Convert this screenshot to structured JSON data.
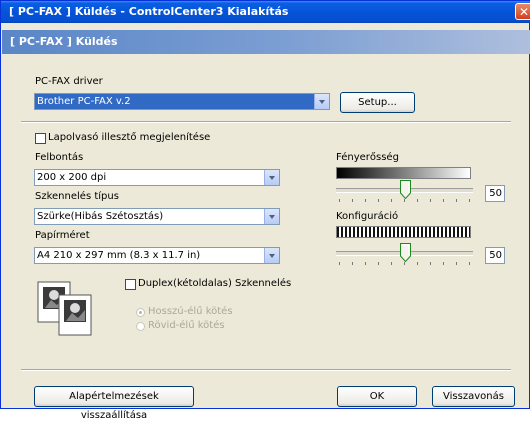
{
  "window": {
    "title": "[ PC-FAX ]  Küldés - ControlCenter3 Kialakítás",
    "close_glyph": "✕"
  },
  "header": {
    "title": "[ PC-FAX ]  Küldés"
  },
  "driver": {
    "label": "PC-FAX driver",
    "value": "Brother PC-FAX v.2",
    "setup_label": "Setup..."
  },
  "preview": {
    "checkbox_label": "Lapolvasó illesztő megjelenítése",
    "checked": false
  },
  "resolution": {
    "label": "Felbontás",
    "value": "200 x 200 dpi"
  },
  "scan_type": {
    "label": "Szkennelés típus",
    "value": "Szürke(Hibás Szétosztás)"
  },
  "paper_size": {
    "label": "Papírméret",
    "value": "A4 210 x 297 mm (8.3 x 11.7 in)"
  },
  "duplex": {
    "checkbox_label": "Duplex(kétoldalas) Szkennelés",
    "checked": false,
    "options": [
      {
        "label": "Hosszú-élű kötés",
        "selected": true
      },
      {
        "label": "Rövid-élű kötés",
        "selected": false
      }
    ]
  },
  "brightness": {
    "label": "Fényerősség",
    "value": "50",
    "level": 0.5
  },
  "contrast": {
    "label": "Konfiguráció",
    "value": "50",
    "level": 0.5
  },
  "footer": {
    "restore_label": "Alapértelmezések visszaállítása",
    "ok_label": "OK",
    "cancel_label": "Visszavonás"
  },
  "colors": {
    "title_blue": "#0653d8",
    "header_band": "#6b92cc",
    "dialog_bg": "#ece9d8",
    "selection": "#316ac5"
  }
}
